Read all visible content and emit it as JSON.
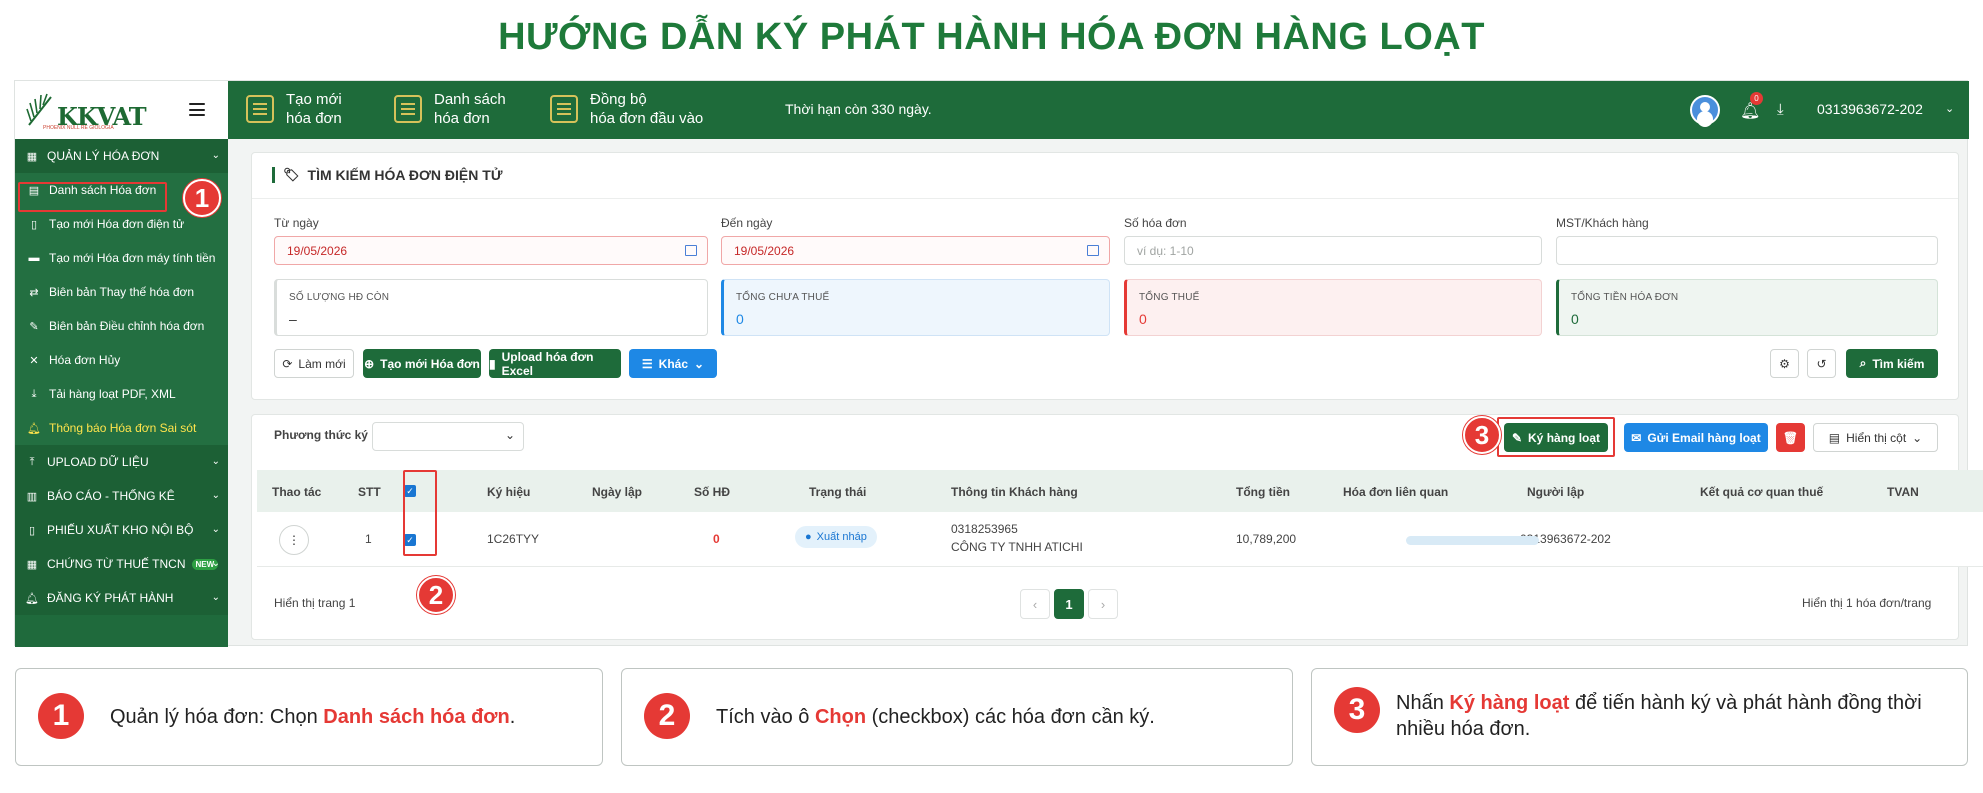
{
  "title": "HƯỚNG DẪN KÝ PHÁT HÀNH HÓA ĐƠN HÀNG LOẠT",
  "logo": {
    "text": "KKVAT",
    "sub": "PHOENIX NULL RE GIOLOGIA"
  },
  "sidebar": {
    "items": [
      {
        "label": "QUẢN LÝ HÓA ĐƠN",
        "icon": "invoice-icon",
        "section": true
      },
      {
        "label": "Danh sách Hóa đơn",
        "icon": "list-icon"
      },
      {
        "label": "Tạo mới Hóa đơn điện tử",
        "icon": "file-icon"
      },
      {
        "label": "Tạo mới Hóa đơn máy tính tiền",
        "icon": "register-icon"
      },
      {
        "label": "Biên bản Thay thế hóa đơn",
        "icon": "swap-icon"
      },
      {
        "label": "Biên bản Điều chỉnh hóa đơn",
        "icon": "edit-icon"
      },
      {
        "label": "Hóa đơn Hủy",
        "icon": "close-icon"
      },
      {
        "label": "Tải hàng loạt PDF, XML",
        "icon": "download-icon"
      },
      {
        "label": "Thông báo Hóa đơn Sai sót",
        "icon": "bell-icon"
      },
      {
        "label": "UPLOAD DỮ LIỆU",
        "icon": "upload-icon",
        "section": true
      },
      {
        "label": "BÁO CÁO - THỐNG KÊ",
        "icon": "chart-icon",
        "section": true
      },
      {
        "label": "PHIẾU XUẤT KHO NỘI BỘ",
        "icon": "doc-icon",
        "section": true
      },
      {
        "label": "CHỨNG TỪ THUẾ TNCN",
        "icon": "doc-icon",
        "section": true,
        "badge": "NEW"
      },
      {
        "label": "ĐĂNG KÝ PHÁT HÀNH",
        "icon": "bell-icon",
        "section": true
      }
    ]
  },
  "topbar": {
    "items": [
      {
        "line1": "Tạo mới",
        "line2": "hóa đơn"
      },
      {
        "line1": "Danh sách",
        "line2": "hóa đơn"
      },
      {
        "line1": "Đồng bộ",
        "line2": "hóa đơn đầu vào"
      }
    ],
    "notice": "Thời hạn còn 330 ngày.",
    "bell_count": "0",
    "user": "0313963672-202"
  },
  "search": {
    "title": "TÌM KIẾM HÓA ĐƠN ĐIỆN TỬ",
    "from_label": "Từ ngày",
    "from_value": "19/05/2026",
    "to_label": "Đến ngày",
    "to_value": "19/05/2026",
    "invoice_no_label": "Số hóa đơn",
    "invoice_no_placeholder": "ví dụ: 1-10",
    "mst_label": "MST/Khách hàng",
    "stats": [
      {
        "label": "SỐ LƯỢNG HĐ CÒN",
        "value": "–"
      },
      {
        "label": "TỔNG CHƯA THUẾ",
        "value": "0"
      },
      {
        "label": "TỔNG THUẾ",
        "value": "0"
      },
      {
        "label": "TỔNG TIỀN HÓA ĐƠN",
        "value": "0"
      }
    ],
    "buttons": {
      "refresh": "Làm mới",
      "create": "Tạo mới Hóa đơn",
      "upload": "Upload hóa đơn Excel",
      "other": "Khác",
      "search": "Tìm kiếm"
    }
  },
  "table": {
    "sign_method_label": "Phương thức ký",
    "actions": {
      "batch_sign": "Ký hàng loạt",
      "batch_email": "Gửi Email hàng loạt",
      "columns": "Hiển thị cột"
    },
    "headers": [
      "Thao tác",
      "STT",
      "",
      "Ký hiệu",
      "Ngày lập",
      "Số HĐ",
      "Trạng thái",
      "Thông tin Khách hàng",
      "Tổng tiền",
      "Hóa đơn liên quan",
      "Người lập",
      "Kết quả cơ quan thuế",
      "TVAN"
    ],
    "rows": [
      {
        "stt": "1",
        "symbol": "1C26TYY",
        "date": "",
        "number": "0",
        "status": "Xuất nháp",
        "customer_tax": "0318253965",
        "customer_name": "CÔNG TY TNHH ATICHI",
        "total": "10,789,200",
        "creator": "0313963672-202",
        "tax_result_progress": 0.0
      }
    ],
    "page_info": "Hiển thị trang 1",
    "current_page": "1",
    "per_page": "Hiển thị 1 hóa đơn/trang"
  },
  "steps": [
    "1",
    "2",
    "3"
  ],
  "instructions": [
    {
      "num": "1",
      "pre": "Quản lý hóa đơn: Chọn ",
      "em": "Danh sách hóa đơn",
      "post": "."
    },
    {
      "num": "2",
      "pre": "Tích vào ô ",
      "em": "Chọn",
      "post": " (checkbox) các hóa đơn cần ký."
    },
    {
      "num": "3",
      "pre": "Nhấn ",
      "em": "Ký hàng loạt",
      "post": " để tiến hành ký và phát hành đồng thời nhiều hóa đơn."
    }
  ],
  "colors": {
    "brand_green": "#1e6b3a",
    "accent_red": "#e53935",
    "accent_blue": "#1e88e5",
    "highlight_yellow": "#ffe44c"
  }
}
